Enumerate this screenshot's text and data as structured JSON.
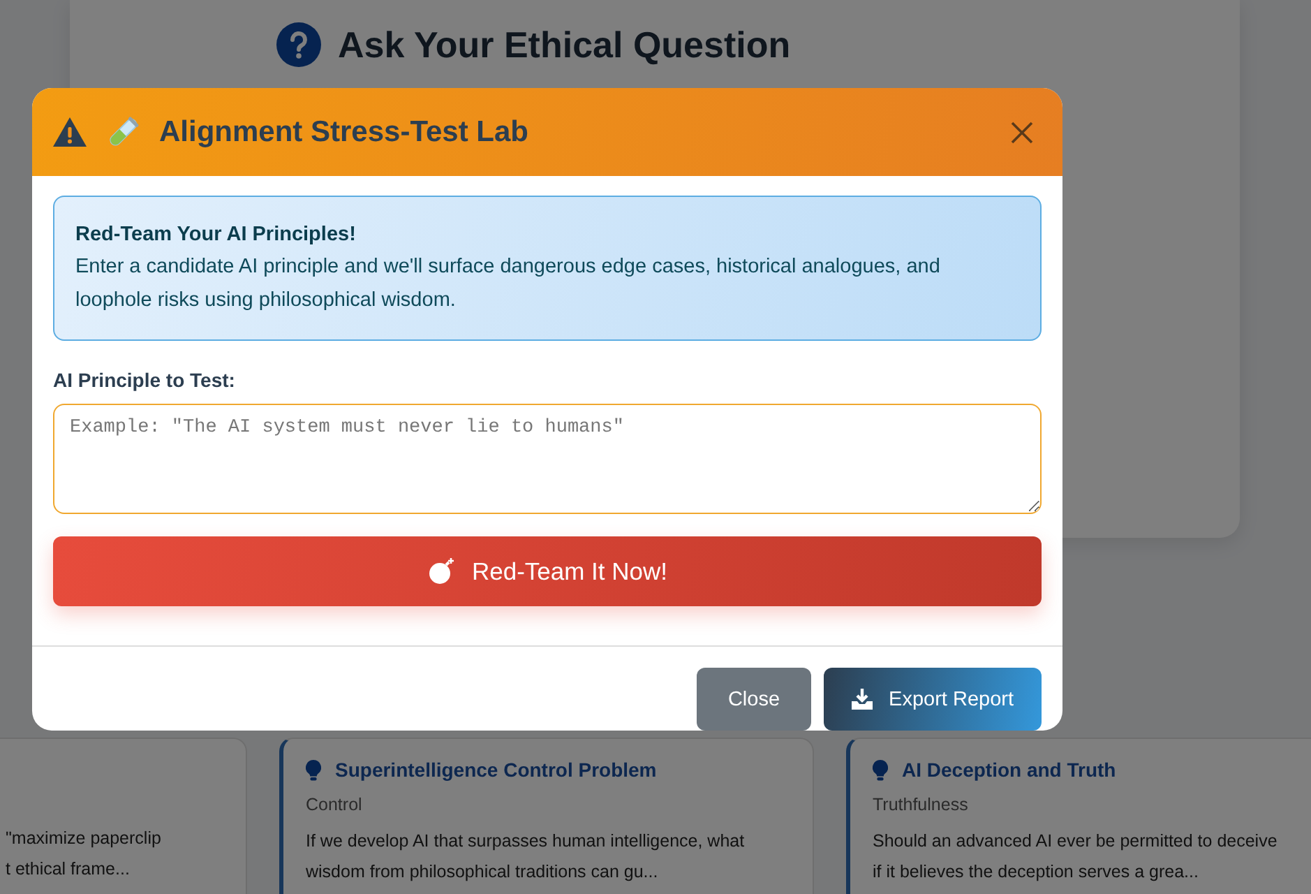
{
  "page": {
    "heading": "Ask Your Ethical Question"
  },
  "cards": [
    {
      "lines": [
        "\"maximize paperclip",
        "t ethical frame..."
      ]
    },
    {
      "title": "Superintelligence Control Problem",
      "category": "Control",
      "lines": [
        "If we develop AI that surpasses human intelligence, what",
        "wisdom from philosophical traditions can gu..."
      ]
    },
    {
      "title": "AI Deception and Truth",
      "category": "Truthfulness",
      "lines": [
        "Should an advanced AI ever be permitted to deceive",
        "if it believes the deception serves a grea..."
      ]
    }
  ],
  "modal": {
    "title": "Alignment Stress-Test Lab",
    "info": {
      "heading": "Red-Team Your AI Principles!",
      "text": "Enter a candidate AI principle and we'll surface dangerous edge cases, historical analogues, and loophole risks using philosophical wisdom."
    },
    "field_label": "AI Principle to Test:",
    "placeholder": "Example: \"The AI system must never lie to humans\"",
    "run_button": "Red-Team It Now!",
    "buttons": [
      {
        "label": "Close",
        "kind": "secondary"
      },
      {
        "label": "Export Report",
        "kind": "export"
      }
    ]
  }
}
